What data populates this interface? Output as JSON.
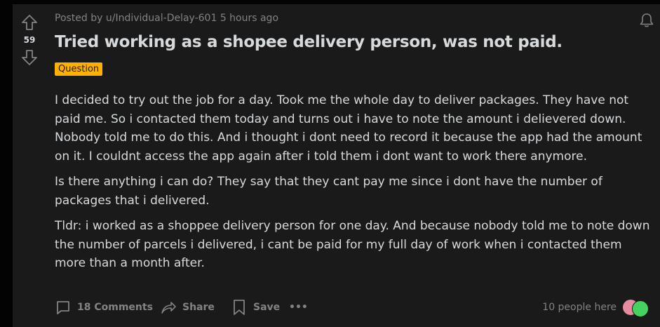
{
  "post": {
    "score": "59",
    "meta": "Posted by u/Individual-Delay-601 5 hours ago",
    "title": "Tried working as a shopee delivery person, was not paid.",
    "flair": "Question",
    "body": [
      "I decided to try out the job for a day. Took me the whole day to deliver packages. They have not paid me. So i contacted them today and turns out i have to note the amount i delievered down. Nobody told me to do this. And i thought i dont need to record it because the app had the amount on it. I couldnt access the app again after i told them i dont want to work there anymore.",
      "Is there anything i can do? They say that they cant pay me since i dont have the number of packages that i delivered.",
      "Tldr: i worked as a shoppee delivery person for one day. And because nobody told me to note down the number of parcels i delivered, i cant be paid for my full day of work when i contacted them more than a month after."
    ]
  },
  "actions": {
    "comments": "18 Comments",
    "share": "Share",
    "save": "Save",
    "more": "•••",
    "people_here": "10 people here"
  },
  "icons": {
    "upvote": "arrow-up-icon",
    "downvote": "arrow-down-icon",
    "notification": "bell-icon",
    "comments": "comment-bubble-icon",
    "share": "share-arrow-icon",
    "save": "bookmark-icon"
  },
  "colors": {
    "background": "#030303",
    "card": "#1a1a1b",
    "text": "#d7dadc",
    "muted": "#818384",
    "flair": "#ffb000"
  }
}
